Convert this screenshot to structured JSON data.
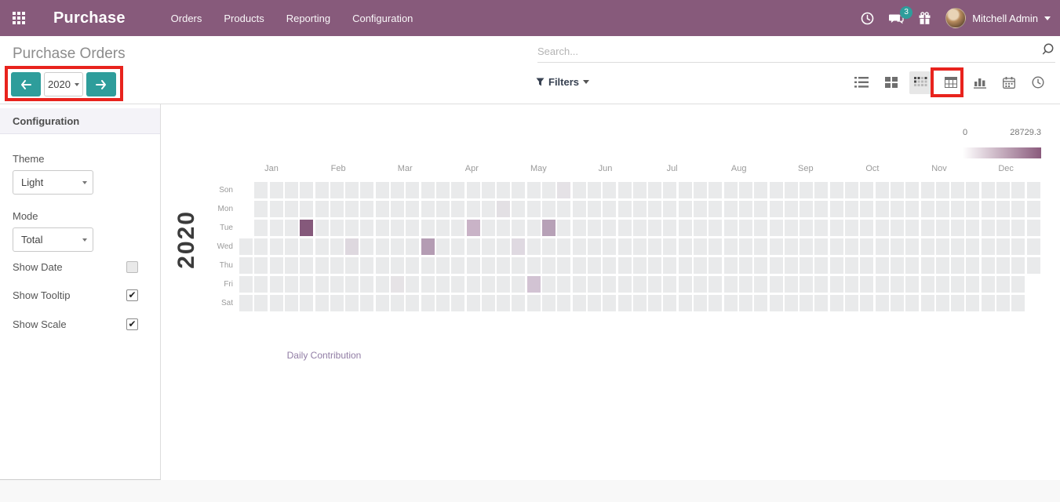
{
  "navbar": {
    "app_name": "Purchase",
    "menu_items": [
      "Orders",
      "Products",
      "Reporting",
      "Configuration"
    ],
    "message_badge": "3",
    "user_name": "Mitchell Admin",
    "color": "#875A7B"
  },
  "control_panel": {
    "title": "Purchase Orders",
    "search": {
      "placeholder": "Search..."
    },
    "filters_label": "Filters",
    "year_nav": {
      "year": "2020"
    },
    "view_switcher": {
      "views": [
        "list",
        "kanban",
        "heatmap",
        "pivot",
        "graph",
        "calendar",
        "clock"
      ],
      "active": "heatmap"
    }
  },
  "sidebar": {
    "header": "Configuration",
    "fields": [
      {
        "label": "Theme",
        "value": "Light"
      },
      {
        "label": "Mode",
        "value": "Total"
      }
    ],
    "toggles": [
      {
        "label": "Show Date",
        "checked": false
      },
      {
        "label": "Show Tooltip",
        "checked": true
      },
      {
        "label": "Show Scale",
        "checked": true
      }
    ]
  },
  "chart_data": {
    "type": "heatmap",
    "title": "Daily Contribution",
    "year_label": "2020",
    "scale": {
      "min_label": "0",
      "max_label": "28729.3",
      "min_color": "#FFFFFF",
      "max_color": "#8A5A7C"
    },
    "months": [
      "Jan",
      "Feb",
      "Mar",
      "Apr",
      "May",
      "Jun",
      "Jul",
      "Aug",
      "Sep",
      "Oct",
      "Nov",
      "Dec"
    ],
    "day_rows": [
      "Son",
      "Mon",
      "Tue",
      "Wed",
      "Thu",
      "Fri",
      "Sat"
    ],
    "grid": {
      "columns": 53,
      "row_start_col": {
        "Son": 1,
        "Mon": 1,
        "Tue": 1,
        "Wed": 0,
        "Thu": 0,
        "Fri": 0,
        "Sat": 0
      },
      "row_end_col": {
        "Son": 52,
        "Mon": 52,
        "Tue": 52,
        "Wed": 52,
        "Thu": 52,
        "Fri": 51,
        "Sat": 51
      },
      "base_cell_color": "#E9EAEB"
    },
    "colored_cells": [
      {
        "day": "Tue",
        "week": 4,
        "color": "#85597B"
      },
      {
        "day": "Wed",
        "week": 7,
        "color": "#DED8DF"
      },
      {
        "day": "Fri",
        "week": 10,
        "color": "#E6E3E6"
      },
      {
        "day": "Wed",
        "week": 12,
        "color": "#B49CB3"
      },
      {
        "day": "Tue",
        "week": 15,
        "color": "#C9B3C7"
      },
      {
        "day": "Mon",
        "week": 17,
        "color": "#E3E0E4"
      },
      {
        "day": "Wed",
        "week": 18,
        "color": "#DFD9E1"
      },
      {
        "day": "Fri",
        "week": 19,
        "color": "#D2C3D3"
      },
      {
        "day": "Tue",
        "week": 20,
        "color": "#B7A1B7"
      },
      {
        "day": "Son",
        "week": 21,
        "color": "#E5E2E6"
      }
    ]
  },
  "annotations": {
    "highlight_color": "#E8231D"
  }
}
